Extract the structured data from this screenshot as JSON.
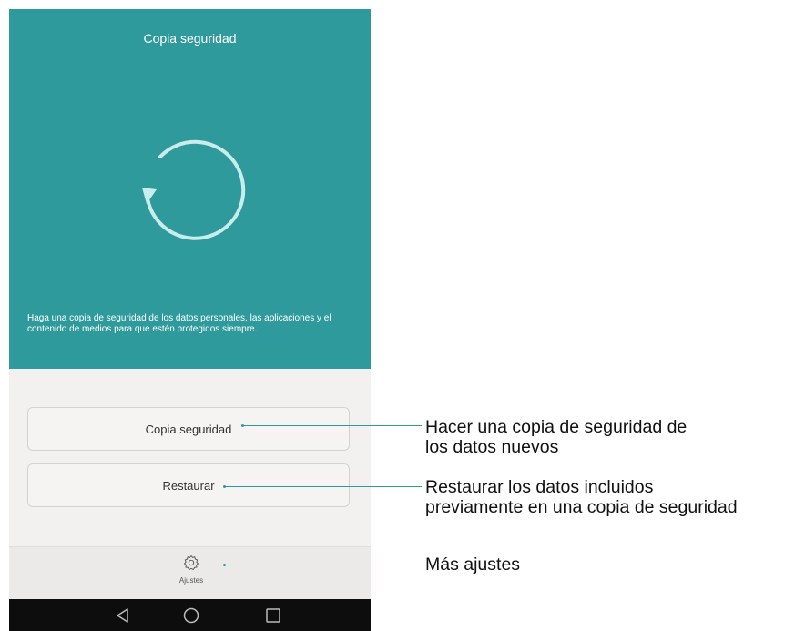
{
  "app": {
    "title": "Copia seguridad",
    "description": "Haga una copia de seguridad de los datos personales, las aplicaciones y el contenido de medios para que estén protegidos siempre.",
    "accent_color": "#2f9a9b"
  },
  "buttons": {
    "backup_label": "Copia seguridad",
    "restore_label": "Restaurar"
  },
  "bottom_bar": {
    "settings_label": "Ajustes",
    "settings_icon": "gear-icon"
  },
  "navbar": {
    "back_icon": "back-triangle-icon",
    "home_icon": "home-circle-icon",
    "recent_icon": "recent-square-icon"
  },
  "callouts": {
    "backup_line1": "Hacer una copia de seguridad de",
    "backup_line2": "los datos nuevos",
    "restore_line1": "Restaurar los datos incluidos",
    "restore_line2": "previamente en una copia de seguridad",
    "settings": "Más ajustes"
  }
}
